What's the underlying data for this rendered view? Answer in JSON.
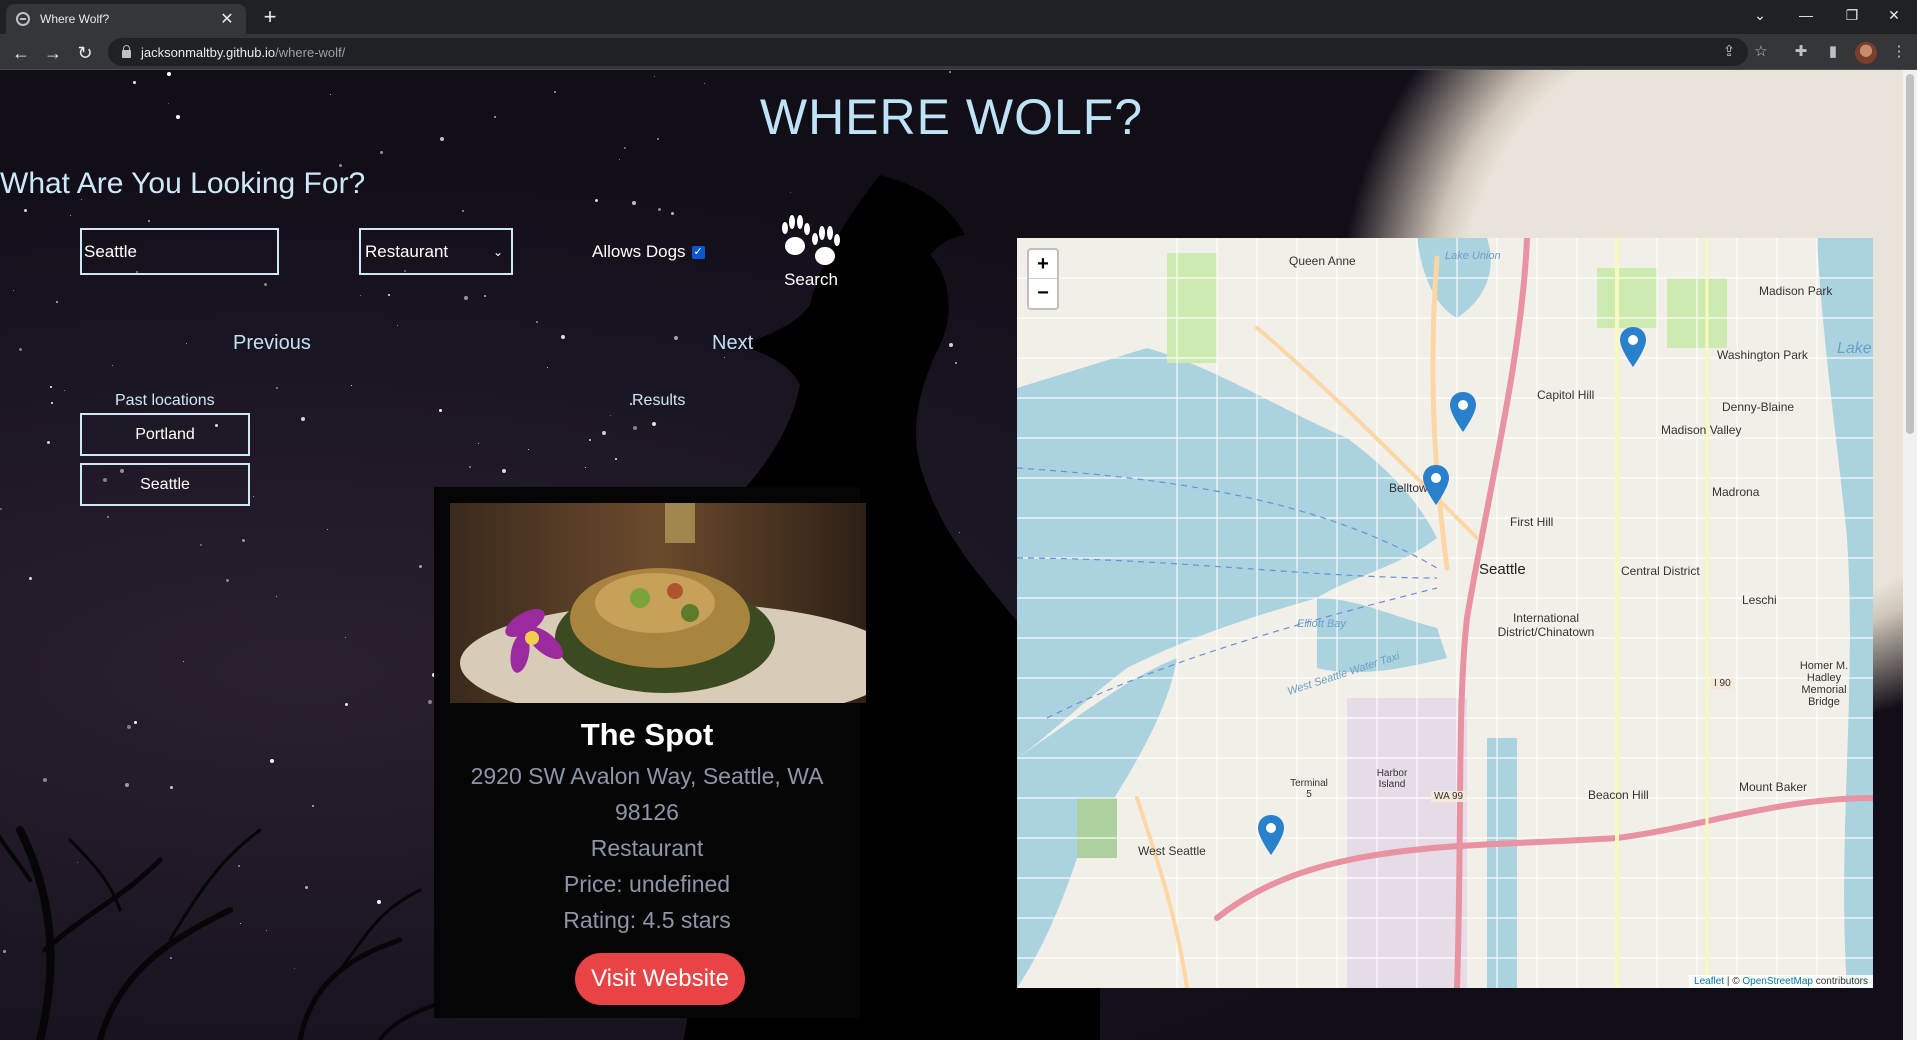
{
  "browser": {
    "tab_title": "Where Wolf?",
    "tab_close": "✕",
    "new_tab": "+",
    "url_domain": "jacksonmaltby.github.io",
    "url_path": "/where-wolf/"
  },
  "header": {
    "title": "WHERE WOLF?",
    "question": "What Are You Looking For?"
  },
  "search": {
    "city_value": "Seattle",
    "type_selected": "Restaurant",
    "dogs_label": "Allows Dogs",
    "dogs_checked": true,
    "search_label": "Search"
  },
  "pager": {
    "previous": "Previous",
    "next": "Next"
  },
  "past": {
    "label": "Past locations",
    "items": [
      "Portland",
      "Seattle"
    ]
  },
  "results": {
    "label": "Results",
    "card": {
      "name": "The Spot",
      "address_line1": "2920 SW Avalon Way, Seattle, WA",
      "address_line2": "98126",
      "category": "Restaurant",
      "price": "Price: undefined",
      "rating": "Rating: 4.5 stars",
      "visit": "Visit Website"
    }
  },
  "map": {
    "zoom_in": "+",
    "zoom_out": "−",
    "attribution_leaflet": "Leaflet",
    "attribution_sep": " | © ",
    "attribution_osm": "OpenStreetMap",
    "attribution_tail": " contributors",
    "labels": {
      "queen_anne": "Queen Anne",
      "lake_union": "Lake Union",
      "madison_park": "Madison Park",
      "washington_park": "Washington Park",
      "capitol_hill": "Capitol Hill",
      "denny_blaine": "Denny-Blaine",
      "madison_valley": "Madison Valley",
      "belltown": "Belltown",
      "madrona": "Madrona",
      "first_hill": "First Hill",
      "seattle": "Seattle",
      "central_district": "Central District",
      "leschi": "Leschi",
      "international_district": "International District/Chinatown",
      "homer_hadley": "Homer M. Hadley Memorial Bridge",
      "west_seattle": "West Seattle",
      "mount_baker": "Mount Baker",
      "beacon_hill": "Beacon Hill",
      "lake": "Lake",
      "elliott_bay": "Elliott Bay",
      "water_taxi": "West Seattle Water Taxi",
      "i90": "I 90",
      "wa99": "WA 99",
      "harbor_island": "Harbor Island",
      "terminal5": "Terminal 5"
    }
  },
  "colors": {
    "accent_text": "#bfe3f6",
    "visit_button": "#e84345",
    "pin": "#2a81cb"
  }
}
